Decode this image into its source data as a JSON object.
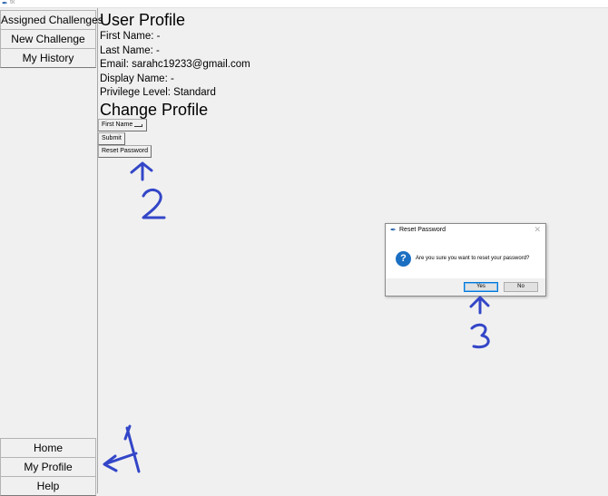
{
  "window": {
    "title": "tk"
  },
  "sidebar": {
    "top_items": [
      {
        "label": "Assigned Challenges"
      },
      {
        "label": "New Challenge"
      },
      {
        "label": "My History"
      }
    ],
    "bottom_items": [
      {
        "label": "Home"
      },
      {
        "label": "My Profile"
      },
      {
        "label": "Help"
      }
    ]
  },
  "profile": {
    "title": "User Profile",
    "first_name": "First Name: -",
    "last_name": "Last Name: -",
    "email": "Email: sarahc19233@gmail.com",
    "display_name": "Display Name: -",
    "privilege": "Privilege Level: Standard"
  },
  "change_profile": {
    "title": "Change Profile",
    "field_selected": "First Name",
    "submit_label": "Submit",
    "reset_label": "Reset Password"
  },
  "dialog": {
    "title": "Reset Password",
    "close_glyph": "✕",
    "icon_glyph": "?",
    "message": "Are you sure you want to reset your password?",
    "yes_label": "Yes",
    "no_label": "No"
  },
  "annotations": {
    "labels": [
      "1",
      "2",
      "3"
    ],
    "color": "#3346c8"
  },
  "colors": {
    "question_icon": "#1a6fc2",
    "default_button_border": "#0078d7"
  }
}
